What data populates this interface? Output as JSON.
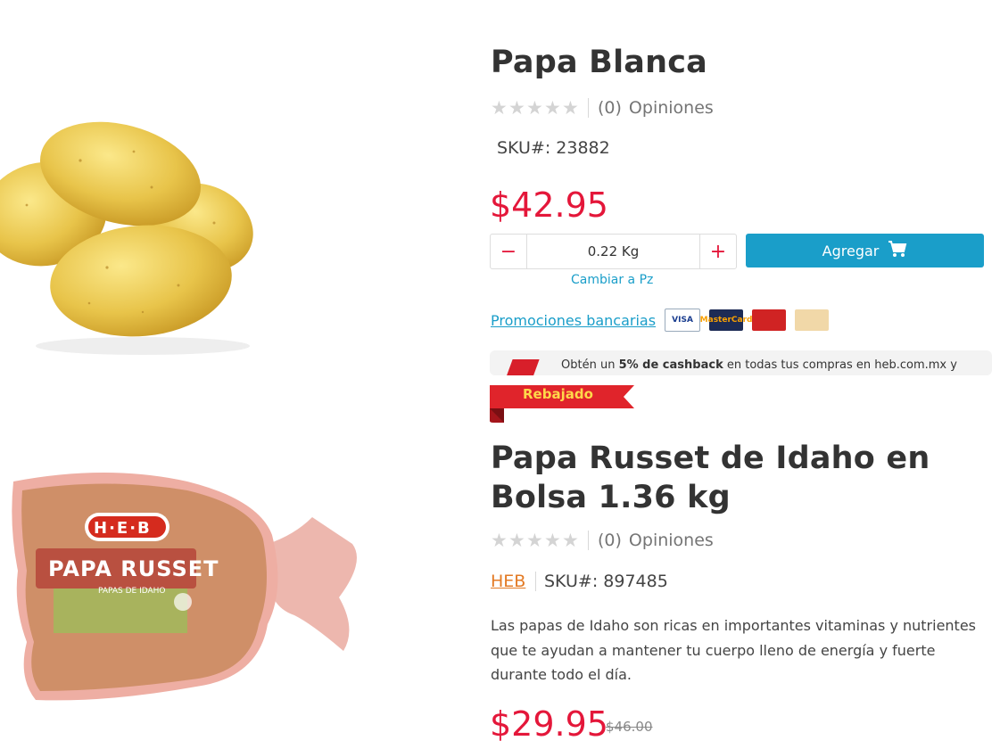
{
  "product1": {
    "title": "Papa Blanca",
    "rating_count": "(0)",
    "rating_label": "Opiniones",
    "sku": "SKU#: 23882",
    "price": "$42.95",
    "quantity_value": "0.22 Kg",
    "minus_label": "−",
    "plus_label": "+",
    "add_button_label": "Agregar",
    "change_unit_label": "Cambiar a Pz",
    "stars_filled": 0,
    "stars_total": 5
  },
  "promotions": {
    "link_label": "Promociones bancarias",
    "cards": [
      "VISA",
      "MasterCard",
      "",
      ""
    ]
  },
  "cashback": {
    "prefix": "Obtén un ",
    "highlight": "5% de cashback",
    "suffix": " en todas tus compras en heb.com.mx y"
  },
  "badge": {
    "label": "Rebajado"
  },
  "product2": {
    "title": "Papa Russet de Idaho en Bolsa 1.36 kg",
    "rating_count": "(0)",
    "rating_label": "Opiniones",
    "brand": "HEB",
    "sku": "SKU#: 897485",
    "description": "Las papas de Idaho son ricas en importantes vitaminas y nutrientes que te ayudan a mantener tu cuerpo lleno de energía y fuerte durante todo el día.",
    "price": "$29.95",
    "old_price": "$46.00",
    "package_logo": "H·E·B",
    "package_label": "PAPA RUSSET",
    "package_sublabel": "PAPAS DE IDAHO",
    "stars_filled": 0,
    "stars_total": 5
  },
  "colors": {
    "price_red": "#e4173a",
    "accent_blue": "#1a9ec9",
    "brand_orange": "#e37a24"
  }
}
